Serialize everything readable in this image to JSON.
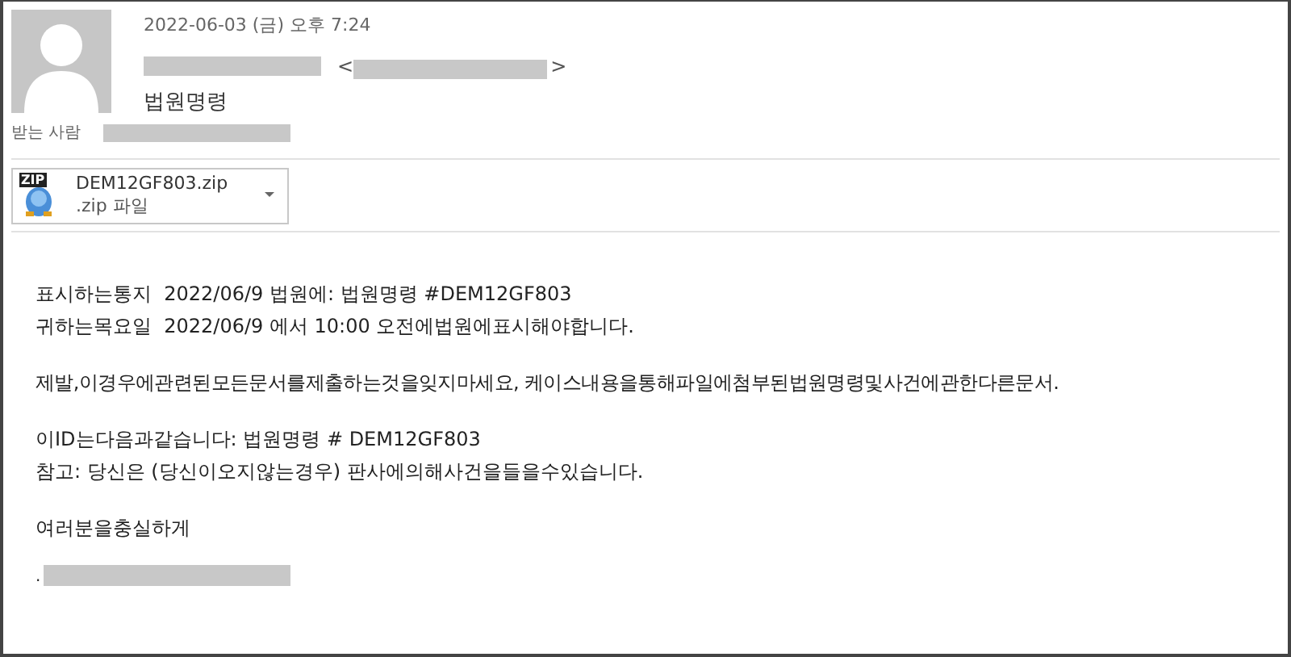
{
  "header": {
    "date": "2022-06-03 (금) 오후 7:24",
    "sender_open": "<",
    "sender_close": ">",
    "subject": "법원명령",
    "to_label": "받는 사람"
  },
  "attachment": {
    "name": "DEM12GF803.zip",
    "type": ".zip 파일",
    "icon_text": "ZIP"
  },
  "body": {
    "lines": [
      "표시하는통지  2022/06/9 법원에: 법원명령 #DEM12GF803",
      "귀하는목요일  2022/06/9 에서 10:00 오전에법원에표시해야합니다."
    ],
    "paragraph": "제발,이경우에관련된모든문서를제출하는것을잊지마세요, 케이스내용을통해파일에첨부된법원명령및사건에관한다른문서.",
    "id_lines": [
      "이ID는다음과같습니다: 법원명령 # DEM12GF803",
      "참고: 당신은 (당신이오지않는경우) 판사에의해사건을들을수있습니다."
    ],
    "closing": "여러분을충실하게",
    "signature_mark": "."
  }
}
